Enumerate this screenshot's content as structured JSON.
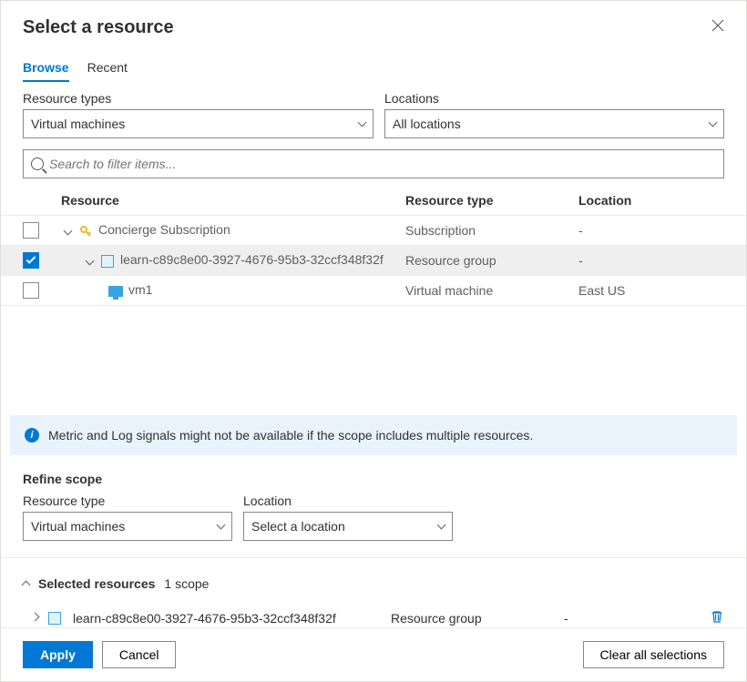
{
  "dialog": {
    "title": "Select a resource"
  },
  "tabs": {
    "browse": "Browse",
    "recent": "Recent"
  },
  "filters": {
    "resource_types_label": "Resource types",
    "resource_types_value": "Virtual machines",
    "locations_label": "Locations",
    "locations_value": "All locations"
  },
  "search": {
    "placeholder": "Search to filter items..."
  },
  "columns": {
    "resource": "Resource",
    "type": "Resource type",
    "location": "Location"
  },
  "rows": [
    {
      "name": "Concierge Subscription",
      "type": "Subscription",
      "location": "-",
      "checked": false,
      "selectedRow": false,
      "indent": 0,
      "expandable": true,
      "icon": "key"
    },
    {
      "name": "learn-c89c8e00-3927-4676-95b3-32ccf348f32f",
      "type": "Resource group",
      "location": "-",
      "checked": true,
      "selectedRow": true,
      "indent": 1,
      "expandable": true,
      "icon": "rg"
    },
    {
      "name": "vm1",
      "type": "Virtual machine",
      "location": "East US",
      "checked": false,
      "selectedRow": false,
      "indent": 2,
      "expandable": false,
      "icon": "vm"
    }
  ],
  "info": {
    "message": "Metric and Log signals might not be available if the scope includes multiple resources."
  },
  "refine": {
    "heading": "Refine scope",
    "resource_type_label": "Resource type",
    "resource_type_value": "Virtual machines",
    "location_label": "Location",
    "location_value": "Select a location"
  },
  "selected": {
    "heading": "Selected resources",
    "count": "1 scope",
    "item_name": "learn-c89c8e00-3927-4676-95b3-32ccf348f32f",
    "item_type": "Resource group",
    "item_location": "-"
  },
  "buttons": {
    "apply": "Apply",
    "cancel": "Cancel",
    "clear": "Clear all selections"
  }
}
